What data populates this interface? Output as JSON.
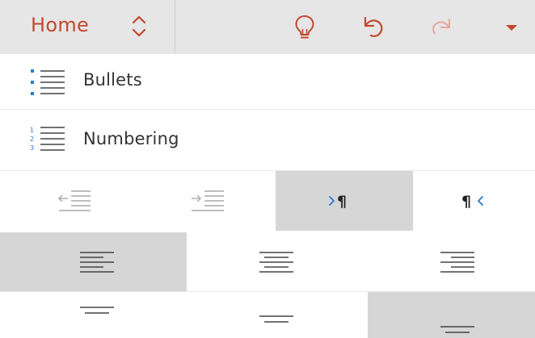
{
  "toolbar": {
    "tab_label": "Home",
    "tab_switch_icon": "chevron-up-down-icon",
    "tell_me_icon": "lightbulb-icon",
    "undo_icon": "undo-icon",
    "redo_icon": "redo-icon",
    "more_icon": "caret-down-icon"
  },
  "list_items": [
    {
      "label": "Bullets",
      "icon": "bullets-icon"
    },
    {
      "label": "Numbering",
      "icon": "numbering-icon"
    }
  ],
  "indent_row": [
    {
      "name": "decrease-indent",
      "icon": "decrease-indent-icon",
      "enabled": false,
      "selected": false
    },
    {
      "name": "increase-indent",
      "icon": "increase-indent-icon",
      "enabled": false,
      "selected": false
    },
    {
      "name": "left-to-right",
      "icon": "ltr-paragraph-icon",
      "enabled": true,
      "selected": true
    },
    {
      "name": "right-to-left",
      "icon": "rtl-paragraph-icon",
      "enabled": true,
      "selected": false
    }
  ],
  "align_row": [
    {
      "name": "align-left",
      "icon": "align-left-icon",
      "selected": true
    },
    {
      "name": "align-center",
      "icon": "align-center-icon",
      "selected": false
    },
    {
      "name": "align-right",
      "icon": "align-right-icon",
      "selected": false
    }
  ],
  "vertical_align_row": [
    {
      "name": "align-top",
      "icon": "align-top-icon",
      "selected": false
    },
    {
      "name": "align-middle",
      "icon": "align-middle-icon",
      "selected": false
    },
    {
      "name": "align-bottom",
      "icon": "align-bottom-icon",
      "selected": true
    }
  ],
  "colors": {
    "accent": "#c4482e",
    "toolbar_bg": "#e6e6e6",
    "selected_cell_bg": "#d6d6d6",
    "bullet_blue": "#2b7cc7"
  }
}
